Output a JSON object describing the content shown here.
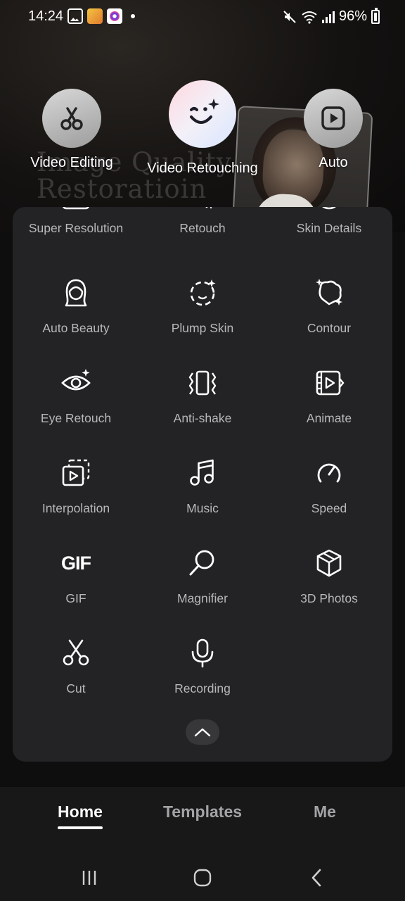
{
  "status_bar": {
    "time": "14:24",
    "battery": "96%",
    "icons": [
      "gallery-icon",
      "app-icon",
      "camera-app-icon",
      "mute-icon",
      "wifi-icon",
      "signal-icon",
      "battery-icon"
    ]
  },
  "hero": {
    "background_text": "Image Quality Restoratioin"
  },
  "top_features": [
    {
      "label": "Video Editing",
      "icon": "scissors-icon"
    },
    {
      "label": "Video Retouching",
      "icon": "smile-sparkle-icon"
    },
    {
      "label": "Auto",
      "icon": "play-icon"
    }
  ],
  "tools": [
    {
      "label": "Super Resolution",
      "icon": "super-resolution-icon"
    },
    {
      "label": "Retouch",
      "icon": "magic-wand-icon"
    },
    {
      "label": "Skin Details",
      "icon": "skin-icon"
    },
    {
      "label": "Auto Beauty",
      "icon": "woman-face-icon"
    },
    {
      "label": "Plump Skin",
      "icon": "plump-face-icon"
    },
    {
      "label": "Contour",
      "icon": "contour-icon"
    },
    {
      "label": "Eye Retouch",
      "icon": "eye-icon"
    },
    {
      "label": "Anti-shake",
      "icon": "anti-shake-icon"
    },
    {
      "label": "Animate",
      "icon": "animate-icon"
    },
    {
      "label": "Interpolation",
      "icon": "interpolation-icon"
    },
    {
      "label": "Music",
      "icon": "music-note-icon"
    },
    {
      "label": "Speed",
      "icon": "speedometer-icon"
    },
    {
      "label": "GIF",
      "icon": "gif-icon",
      "icon_text": "GIF"
    },
    {
      "label": "Magnifier",
      "icon": "magnifier-icon"
    },
    {
      "label": "3D Photos",
      "icon": "cube-icon"
    },
    {
      "label": "Cut",
      "icon": "scissors-icon"
    },
    {
      "label": "Recording",
      "icon": "microphone-icon"
    }
  ],
  "tab_bar": {
    "tabs": [
      {
        "label": "Home",
        "active": true
      },
      {
        "label": "Templates",
        "active": false
      },
      {
        "label": "Me",
        "active": false
      }
    ]
  },
  "colors": {
    "panel_bg": "#232325",
    "label_gray": "#b8b8bb",
    "tab_active": "#ffffff",
    "tab_inactive": "#a3a3a6"
  }
}
